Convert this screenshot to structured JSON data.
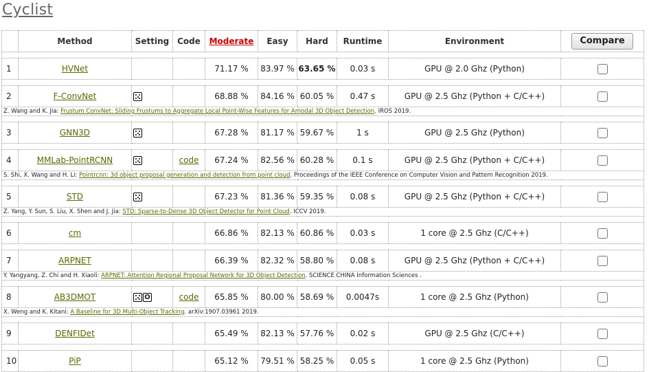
{
  "page": {
    "title": "Cyclist"
  },
  "table": {
    "headers": {
      "method": "Method",
      "setting": "Setting",
      "code": "Code",
      "moderate": "Moderate",
      "easy": "Easy",
      "hard": "Hard",
      "runtime": "Runtime",
      "environment": "Environment",
      "compare": "Compare"
    },
    "rows": [
      {
        "rank": "1",
        "method": "HVNet",
        "setting": [],
        "code": "",
        "moderate": "71.17 %",
        "easy": "83.97 %",
        "hard": "63.65 %",
        "hard_bold": true,
        "runtime": "0.03 s",
        "environment": "GPU @ 2.0 Ghz (Python)",
        "ref": null
      },
      {
        "rank": "2",
        "method": "F-ConvNet",
        "setting": [
          "stereo"
        ],
        "code": "",
        "moderate": "68.88 %",
        "easy": "84.16 %",
        "hard": "60.05 %",
        "runtime": "0.47 s",
        "environment": "GPU @ 2.5 Ghz (Python + C/C++)",
        "ref": {
          "authors": "Z. Wang and K. Jia: ",
          "title": "Frustum ConvNet: Sliding Frustums to Aggregate Local Point-Wise Features for Amodal 3D Object Detection",
          "venue": ". IROS 2019."
        }
      },
      {
        "rank": "3",
        "method": "GNN3D",
        "setting": [
          "stereo"
        ],
        "code": "",
        "moderate": "67.28 %",
        "easy": "81.17 %",
        "hard": "59.67 %",
        "runtime": "1 s",
        "environment": "GPU @ 2.5 Ghz (Python)",
        "ref": null
      },
      {
        "rank": "4",
        "method": "MMLab-PointRCNN",
        "setting": [
          "stereo"
        ],
        "code": "code",
        "moderate": "67.24 %",
        "easy": "82.56 %",
        "hard": "60.28 %",
        "runtime": "0.1 s",
        "environment": "GPU @ 2.5 Ghz (Python + C/C++)",
        "ref": {
          "authors": "S. Shi, X. Wang and H. Li: ",
          "title": "Pointrcnn: 3d object proposal generation and detection from point cloud",
          "venue": ". Proceedings of the IEEE Conference on Computer Vision and Pattern Recognition 2019."
        }
      },
      {
        "rank": "5",
        "method": "STD",
        "setting": [
          "stereo"
        ],
        "code": "",
        "moderate": "67.23 %",
        "easy": "81.36 %",
        "hard": "59.35 %",
        "runtime": "0.08 s",
        "environment": "GPU @ 2.5 Ghz (Python + C/C++)",
        "ref": {
          "authors": "Z. Yang, Y. Sun, S. Liu, X. Shen and J. Jia: ",
          "title": "STD: Sparse-to-Dense 3D Object Detector for Point Cloud",
          "venue": ". ICCV 2019."
        }
      },
      {
        "rank": "6",
        "method": "cm",
        "setting": [],
        "code": "",
        "moderate": "66.86 %",
        "easy": "82.13 %",
        "hard": "60.86 %",
        "runtime": "0.03 s",
        "environment": "1 core @ 2.5 Ghz (C/C++)",
        "ref": null
      },
      {
        "rank": "7",
        "method": "ARPNET",
        "setting": [],
        "code": "",
        "moderate": "66.39 %",
        "easy": "82.32 %",
        "hard": "58.80 %",
        "runtime": "0.08 s",
        "environment": "GPU @ 2.5 Ghz (Python + C/C++)",
        "ref": {
          "authors": "Y. Yangyang, Z. Chi and H. Xiaoli: ",
          "title": "ARPNET: Attention Regional Proposal Network for 3D Object Detection",
          "venue": ". SCIENCE CHINA Information Sciences ."
        }
      },
      {
        "rank": "8",
        "method": "AB3DMOT",
        "setting": [
          "stereo",
          "online"
        ],
        "online_letter": "O",
        "code": "code",
        "moderate": "65.85 %",
        "easy": "80.00 %",
        "hard": "58.69 %",
        "runtime": "0.0047s",
        "environment": "1 core @ 2.5 Ghz (Python)",
        "ref": {
          "authors": "X. Weng and K. Kitani: ",
          "title": "A Baseline for 3D Multi-Object Tracking",
          "venue": ". arXiv:1907.03961 2019."
        }
      },
      {
        "rank": "9",
        "method": "DENFIDet",
        "setting": [],
        "code": "",
        "moderate": "65.49 %",
        "easy": "82.13 %",
        "hard": "57.76 %",
        "runtime": "0.02 s",
        "environment": "GPU @ 2.5 Ghz (C/C++)",
        "ref": null
      },
      {
        "rank": "10",
        "method": "PiP",
        "setting": [],
        "code": "",
        "moderate": "65.12 %",
        "easy": "79.51 %",
        "hard": "58.25 %",
        "runtime": "0.05 s",
        "environment": "1 core @ 2.5 Ghz (Python)",
        "ref": null
      }
    ]
  }
}
